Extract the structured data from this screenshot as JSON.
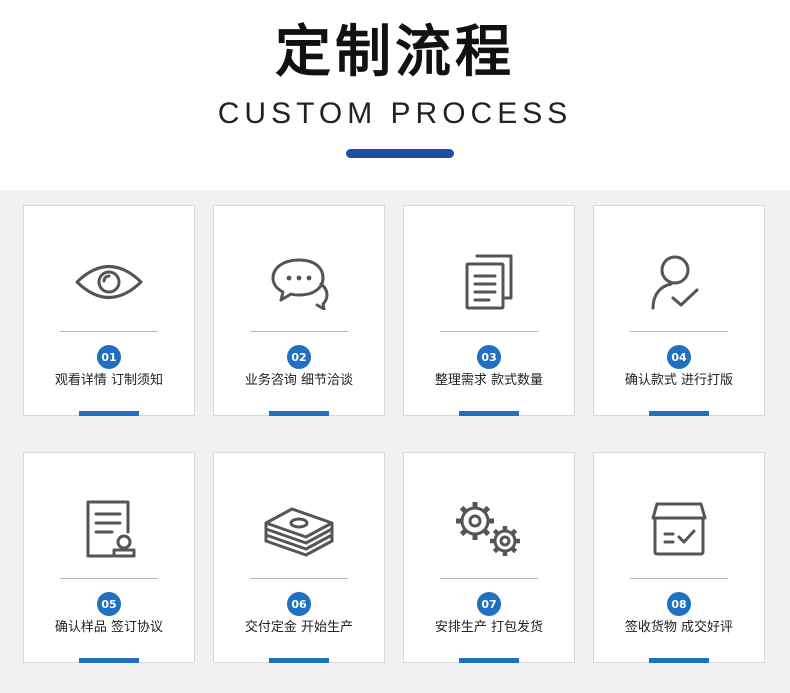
{
  "header": {
    "title": "定制流程",
    "subtitle": "CUSTOM PROCESS"
  },
  "colors": {
    "accent_blue": "#1f6fc2",
    "title_bar_blue": "#1f4fa3",
    "panel_background": "#f1f1f1"
  },
  "steps": [
    {
      "number": "01",
      "label": "观看详情 订制须知",
      "icon": "eye-icon"
    },
    {
      "number": "02",
      "label": "业务咨询 细节洽谈",
      "icon": "chat-bubbles-icon"
    },
    {
      "number": "03",
      "label": "整理需求 款式数量",
      "icon": "documents-icon"
    },
    {
      "number": "04",
      "label": "确认款式 进行打版",
      "icon": "user-check-icon"
    },
    {
      "number": "05",
      "label": "确认样品 签订协议",
      "icon": "certificate-icon"
    },
    {
      "number": "06",
      "label": "交付定金 开始生产",
      "icon": "money-stack-icon"
    },
    {
      "number": "07",
      "label": "安排生产 打包发货",
      "icon": "gears-icon"
    },
    {
      "number": "08",
      "label": "签收货物 成交好评",
      "icon": "box-check-icon"
    }
  ]
}
